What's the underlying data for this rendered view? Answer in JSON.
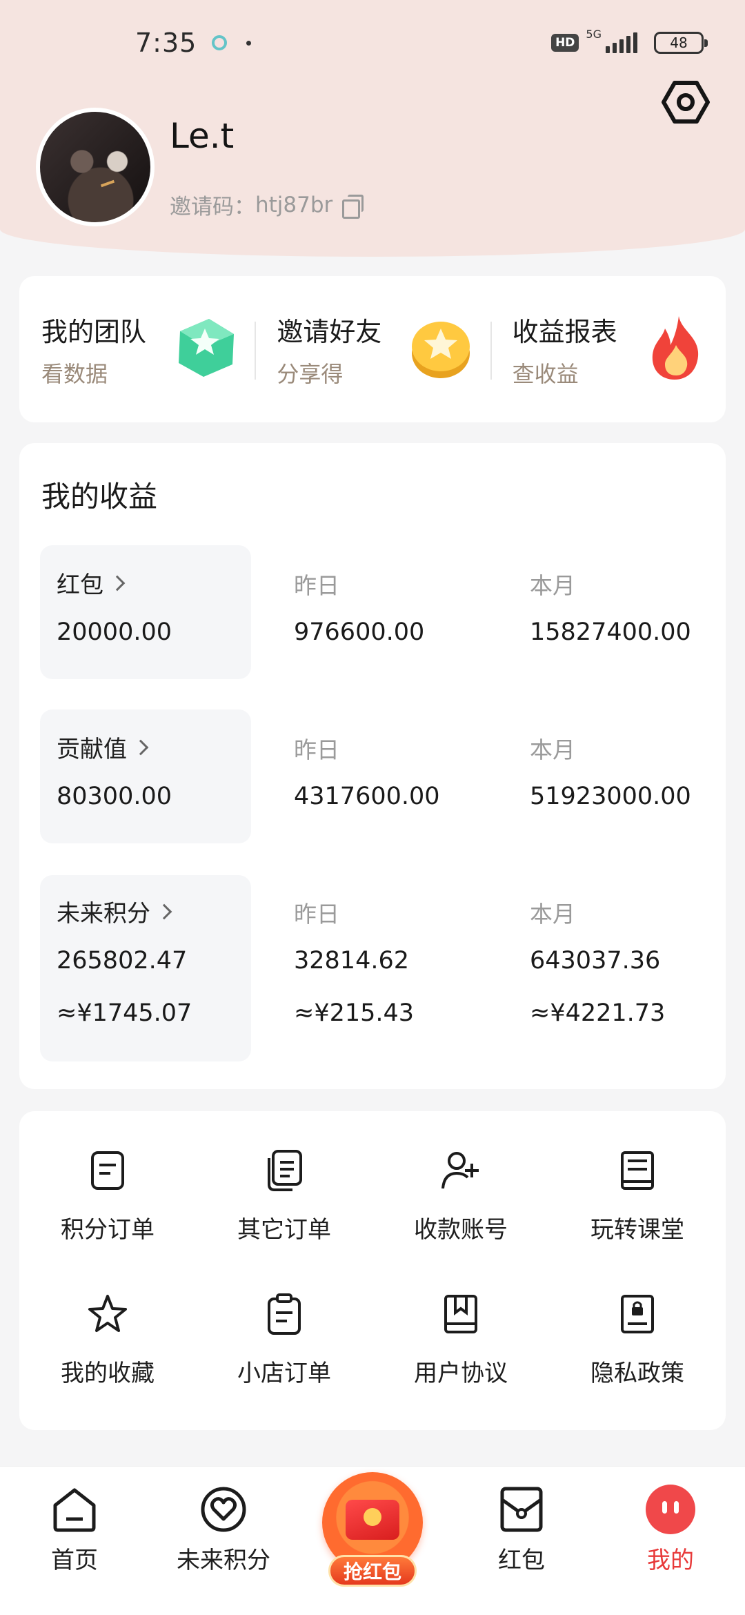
{
  "status_bar": {
    "time": "7:35",
    "network": "5G",
    "hd": "HD",
    "battery": "48"
  },
  "profile": {
    "name": "Le.t",
    "invite_label": "邀请码：",
    "invite_code": "htj87br"
  },
  "quick_actions": [
    {
      "title": "我的团队",
      "subtitle": "看数据",
      "icon": "star-cube-icon"
    },
    {
      "title": "邀请好友",
      "subtitle": "分享得",
      "icon": "star-coin-icon"
    },
    {
      "title": "收益报表",
      "subtitle": "查收益",
      "icon": "flame-icon"
    }
  ],
  "earnings": {
    "title": "我的收益",
    "yesterday_label": "昨日",
    "month_label": "本月",
    "rows": [
      {
        "label": "红包",
        "total": "20000.00",
        "yesterday": "976600.00",
        "month": "15827400.00"
      },
      {
        "label": "贡献值",
        "total": "80300.00",
        "yesterday": "4317600.00",
        "month": "51923000.00"
      },
      {
        "label": "未来积分",
        "total": "265802.47",
        "yesterday": "32814.62",
        "month": "643037.36",
        "total_cny": "≈¥1745.07",
        "yesterday_cny": "≈¥215.43",
        "month_cny": "≈¥4221.73"
      }
    ]
  },
  "menu": [
    {
      "label": "积分订单",
      "icon": "document-icon"
    },
    {
      "label": "其它订单",
      "icon": "documents-icon"
    },
    {
      "label": "收款账号",
      "icon": "add-user-icon"
    },
    {
      "label": "玩转课堂",
      "icon": "book-icon"
    },
    {
      "label": "我的收藏",
      "icon": "star-icon"
    },
    {
      "label": "小店订单",
      "icon": "clipboard-icon"
    },
    {
      "label": "用户协议",
      "icon": "bookmark-book-icon"
    },
    {
      "label": "隐私政策",
      "icon": "lock-document-icon"
    }
  ],
  "tabs": [
    {
      "label": "首页",
      "icon": "home-icon"
    },
    {
      "label": "未来积分",
      "icon": "heart-circle-icon"
    },
    {
      "label": "抢红包",
      "icon": "red-packet-icon"
    },
    {
      "label": "红包",
      "icon": "envelope-icon"
    },
    {
      "label": "我的",
      "icon": "profile-face-icon"
    }
  ],
  "colors": {
    "header_bg": "#f5e4e0",
    "active_tab": "#e83a3a"
  }
}
